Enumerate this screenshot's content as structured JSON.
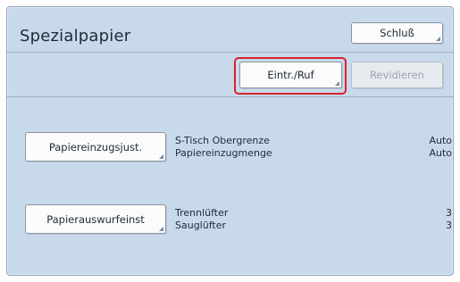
{
  "header": {
    "title": "Spezialpapier",
    "close_label": "Schluß"
  },
  "toolbar": {
    "entry_recall_label": "Eintr./Ruf",
    "revise_label": "Revidieren"
  },
  "settings": [
    {
      "button_label": "Papiereinzugsjust.",
      "rows": [
        {
          "label": "S-Tisch Obergrenze",
          "value": "Auto"
        },
        {
          "label": "Papiereinzugmenge",
          "value": "Auto"
        }
      ]
    },
    {
      "button_label": "Papierauswurfeinst",
      "rows": [
        {
          "label": "Trennlüfter",
          "value": "3"
        },
        {
          "label": "Sauglüfter",
          "value": "3"
        }
      ]
    }
  ]
}
